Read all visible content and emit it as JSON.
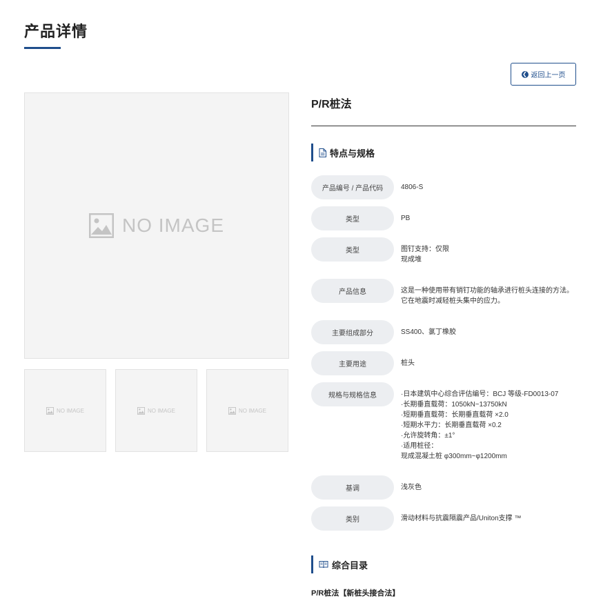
{
  "page": {
    "title": "产品详情"
  },
  "back_button": {
    "label": "返回上一页"
  },
  "gallery": {
    "main_placeholder": "NO IMAGE",
    "thumb_placeholder": "NO IMAGE"
  },
  "product": {
    "name": "P/R桩法"
  },
  "specs": {
    "heading": "特点与规格",
    "rows": [
      {
        "label": "产品编号 / 产品代码",
        "value": "4806-S"
      },
      {
        "label": "类型",
        "value": "PB"
      },
      {
        "label": "类型",
        "value": "图钉支持：仅限\n现成堆"
      },
      {
        "label": "产品信息",
        "value": "这是一种使用带有销钉功能的轴承进行桩头连接的方法。\n它在地震时减轻桩头集中的应力。"
      },
      {
        "label": "主要组成部分",
        "value": "SS400、氯丁橡胶"
      },
      {
        "label": "主要用途",
        "value": "桩头"
      },
      {
        "label": "规格与规格信息",
        "value": "·日本建筑中心综合评估编号：BCJ 等级-FD0013-07\n·长期垂直载荷：1050kN~13750kN\n·短期垂直载荷：长期垂直载荷 ×2.0\n·短期水平力：长期垂直载荷 ×0.2\n·允许旋转角：±1°\n·适用桩径：\n现成混凝土桩 φ300mm~φ1200mm"
      },
      {
        "label": "基调",
        "value": "浅灰色"
      },
      {
        "label": "类别",
        "value": "滑动材料与抗震隔震产品/Uniton支撑 ™"
      }
    ]
  },
  "catalog": {
    "heading": "综合目录",
    "item": "P/R桩法【新桩头接合法】"
  },
  "colors": {
    "accent": "#1f4e8c",
    "label_bg": "#eceef1",
    "placeholder_bg": "#f4f4f4"
  }
}
